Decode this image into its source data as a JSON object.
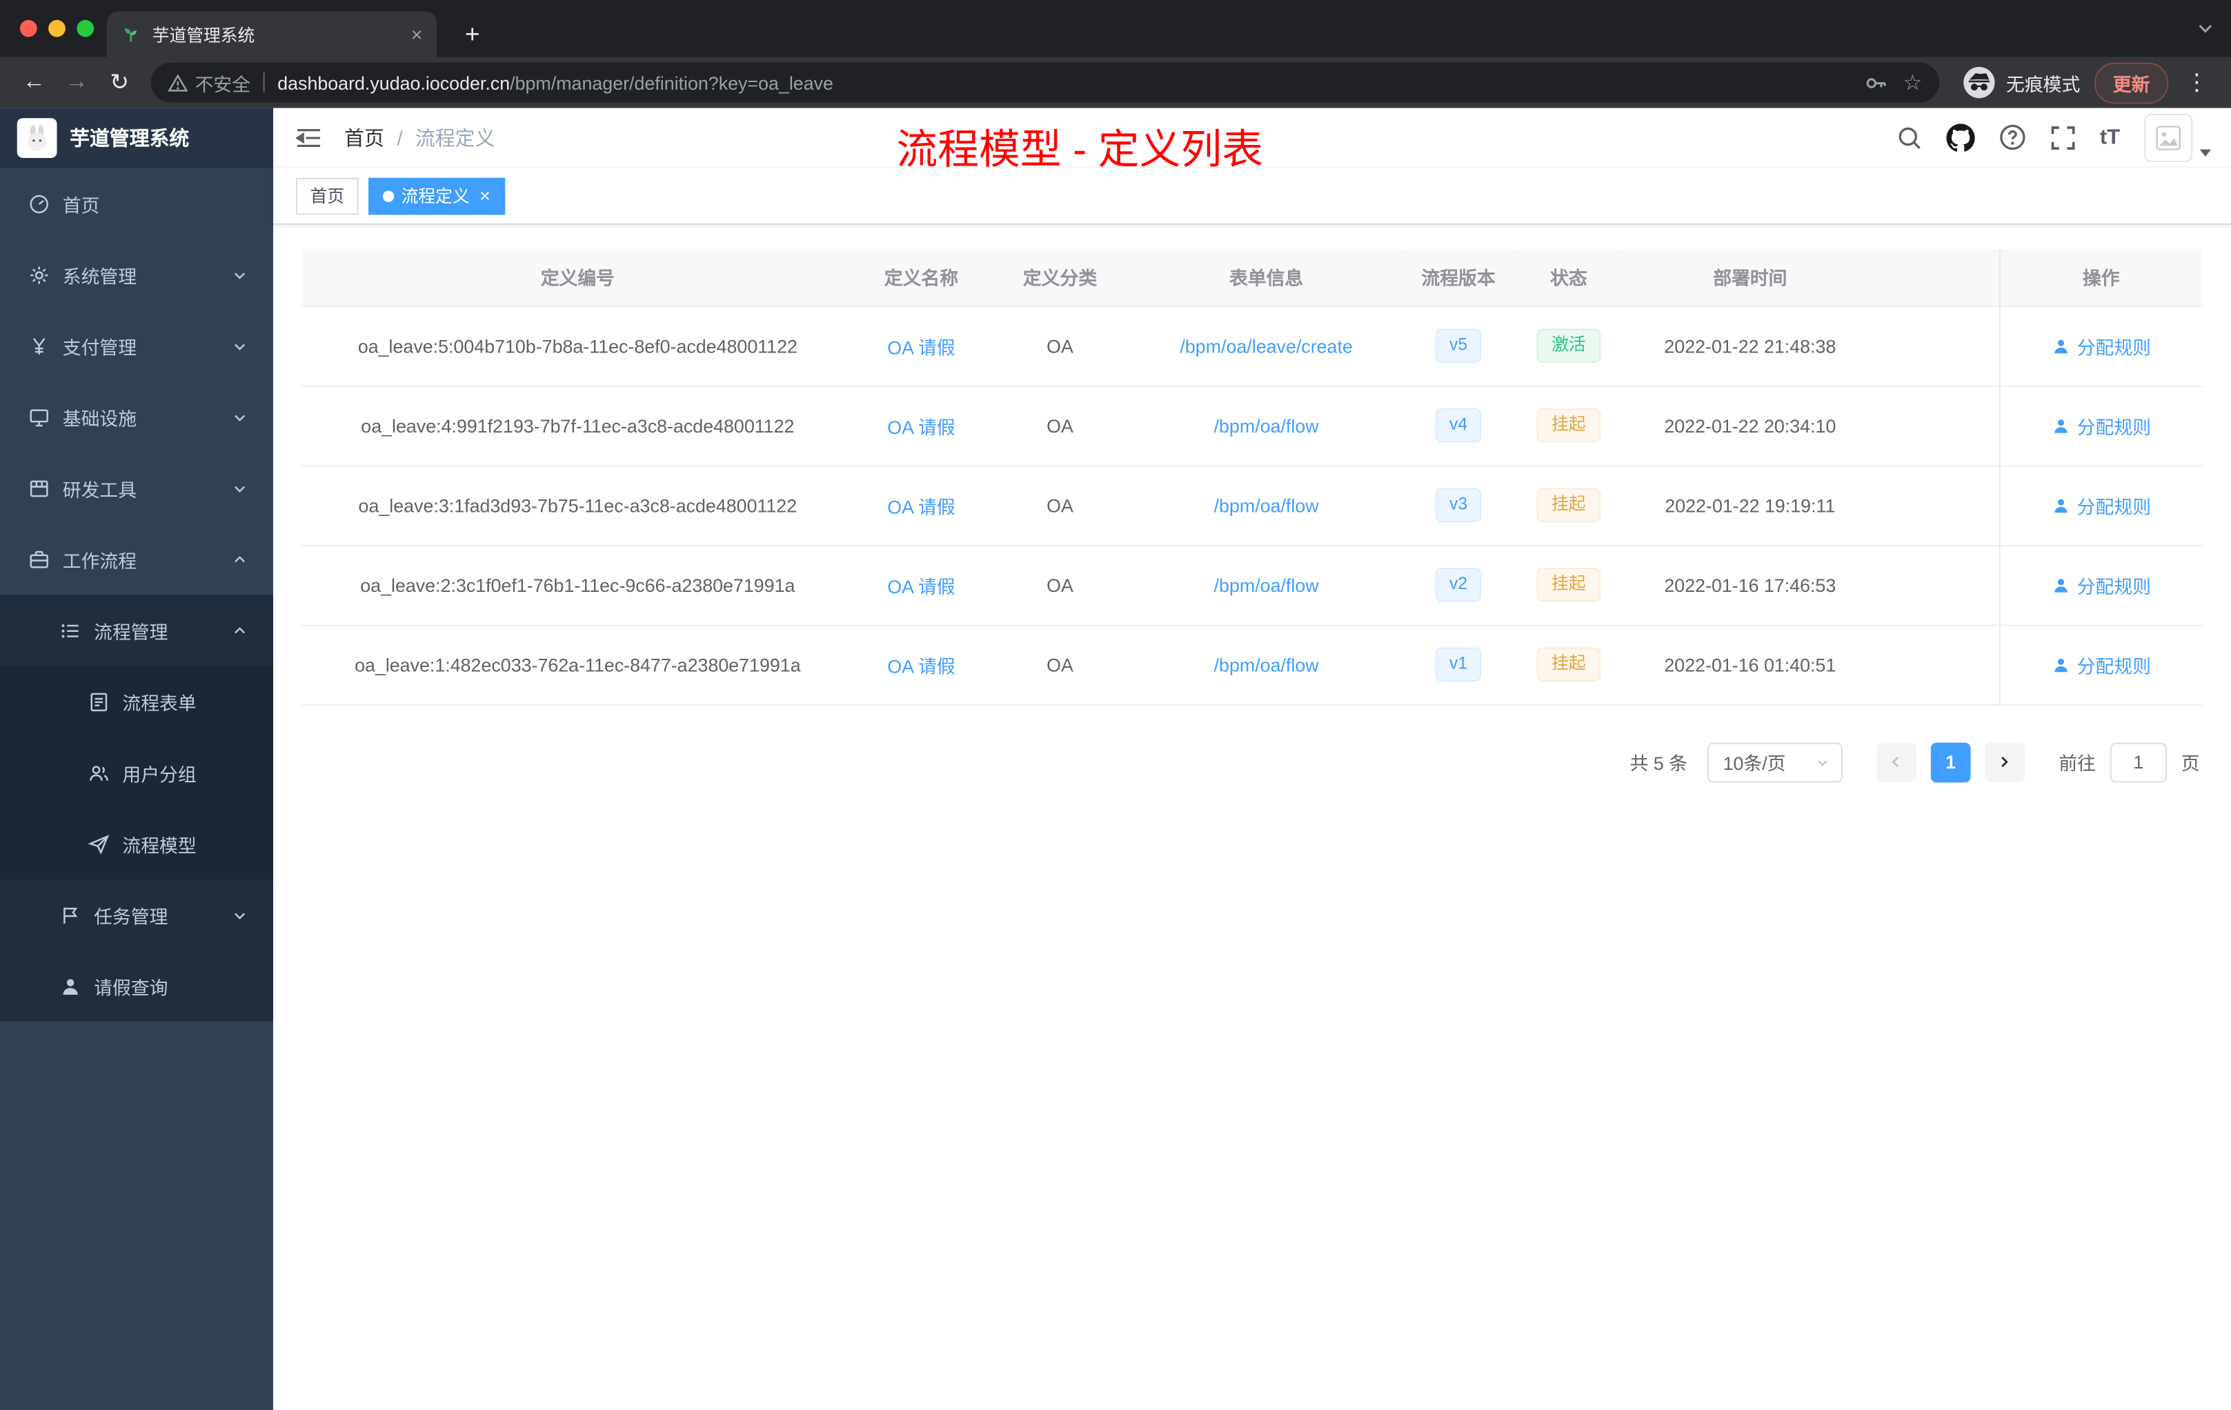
{
  "browser": {
    "tab_title": "芋道管理系统",
    "security_label": "不安全",
    "url_domain": "dashboard.yudao.iocoder.cn",
    "url_path": "/bpm/manager/definition?key=oa_leave",
    "incognito_label": "无痕模式",
    "update_label": "更新"
  },
  "sidebar": {
    "logo_title": "芋道管理系统",
    "items": [
      {
        "label": "首页"
      },
      {
        "label": "系统管理"
      },
      {
        "label": "支付管理"
      },
      {
        "label": "基础设施"
      },
      {
        "label": "研发工具"
      },
      {
        "label": "工作流程"
      },
      {
        "label": "流程管理"
      },
      {
        "label": "流程表单"
      },
      {
        "label": "用户分组"
      },
      {
        "label": "流程模型"
      },
      {
        "label": "任务管理"
      },
      {
        "label": "请假查询"
      }
    ]
  },
  "header": {
    "breadcrumb": {
      "home": "首页",
      "separator": "/",
      "current": "流程定义"
    },
    "annotation": "流程模型 - 定义列表",
    "font_size_icon_label": "tT"
  },
  "tags": {
    "home": "首页",
    "active": "流程定义"
  },
  "table": {
    "columns": [
      "定义编号",
      "定义名称",
      "定义分类",
      "表单信息",
      "流程版本",
      "状态",
      "部署时间",
      "操作"
    ],
    "rows": [
      {
        "id": "oa_leave:5:004b710b-7b8a-11ec-8ef0-acde48001122",
        "name": "OA 请假",
        "category": "OA",
        "form": "/bpm/oa/leave/create",
        "version": "v5",
        "status": "激活",
        "time": "2022-01-22 21:48:38",
        "action": "分配规则"
      },
      {
        "id": "oa_leave:4:991f2193-7b7f-11ec-a3c8-acde48001122",
        "name": "OA 请假",
        "category": "OA",
        "form": "/bpm/oa/flow",
        "version": "v4",
        "status": "挂起",
        "time": "2022-01-22 20:34:10",
        "action": "分配规则"
      },
      {
        "id": "oa_leave:3:1fad3d93-7b75-11ec-a3c8-acde48001122",
        "name": "OA 请假",
        "category": "OA",
        "form": "/bpm/oa/flow",
        "version": "v3",
        "status": "挂起",
        "time": "2022-01-22 19:19:11",
        "action": "分配规则"
      },
      {
        "id": "oa_leave:2:3c1f0ef1-76b1-11ec-9c66-a2380e71991a",
        "name": "OA 请假",
        "category": "OA",
        "form": "/bpm/oa/flow",
        "version": "v2",
        "status": "挂起",
        "time": "2022-01-16 17:46:53",
        "action": "分配规则"
      },
      {
        "id": "oa_leave:1:482ec033-762a-11ec-8477-a2380e71991a",
        "name": "OA 请假",
        "category": "OA",
        "form": "/bpm/oa/flow",
        "version": "v1",
        "status": "挂起",
        "time": "2022-01-16 01:40:51",
        "action": "分配规则"
      }
    ]
  },
  "pagination": {
    "total": "共 5 条",
    "page_size": "10条/页",
    "current_page": "1",
    "goto_label": "前往",
    "goto_value": "1",
    "page_unit": "页"
  },
  "colors": {
    "accent": "#409eff",
    "success": "#23c480",
    "warning": "#e6a23c",
    "annotation_red": "#ff0000",
    "sidebar_bg": "#304156",
    "submenu_bg": "#1f2d3d"
  }
}
